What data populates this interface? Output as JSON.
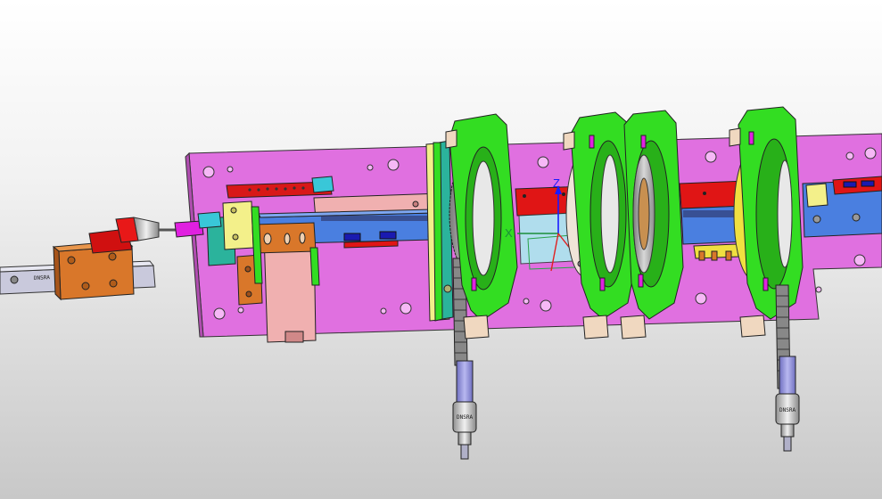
{
  "app": {
    "view": "3D model viewport"
  },
  "triad": {
    "z_label": "Z",
    "x_label": "X",
    "z_color": "#1a1aff",
    "x_color": "#1a8f3a",
    "y_color": "#e02020"
  },
  "colors": {
    "base_plate": "#e070e0",
    "wheel_green": "#33dd22",
    "rail_red": "#e01515",
    "rail_blue": "#4a7fe0",
    "block_orange": "#d9772a",
    "block_pink": "#f0b0b0",
    "gear_grey": "#a8a8a8",
    "rod_lilac": "#8c8cd8",
    "hub_yellow": "#f0e040",
    "accent_cyan": "#39c7d8",
    "accent_magenta": "#e020e0",
    "background_top": "#ffffff",
    "background_bottom": "#c8c8c8"
  },
  "icons": {
    "view_triad": "xyz-axis-triad-icon"
  }
}
